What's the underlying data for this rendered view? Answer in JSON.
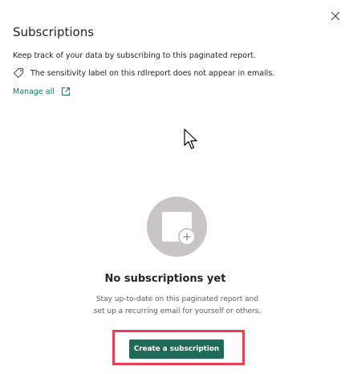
{
  "panel": {
    "title": "Subscriptions",
    "description": "Keep track of your data by subscribing to this paginated report.",
    "sensitivity_notice": "The sensitivity label on this rdlreport does not appear in emails.",
    "manage_all_label": "Manage all",
    "close_icon": "close-icon",
    "tag_icon": "tag-icon",
    "external_link_icon": "external-link-icon"
  },
  "empty_state": {
    "illustration_icon": "empty-subscriptions-illustration",
    "title": "No subscriptions yet",
    "description": "Stay up-to-date on this paginated report and set up a recurring email for yourself or others.",
    "create_button_label": "Create a subscription"
  },
  "colors": {
    "accent": "#117865",
    "button_bg": "#1e6b58",
    "highlight_border": "#e8414e",
    "illustration_circle": "#c8c6c4"
  }
}
